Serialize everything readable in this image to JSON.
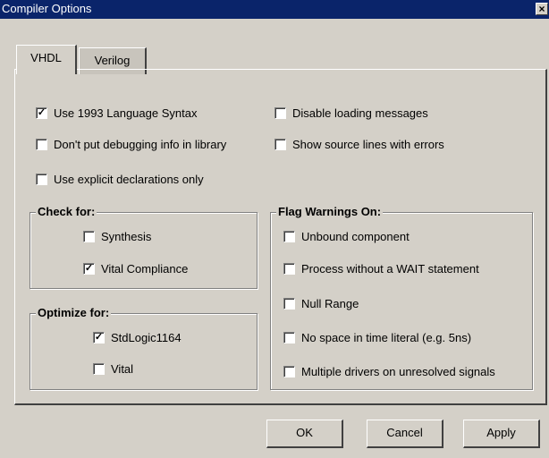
{
  "window": {
    "title": "Compiler Options",
    "close_glyph": "×"
  },
  "tabs": [
    {
      "label": "VHDL",
      "active": true
    },
    {
      "label": "Verilog",
      "active": false
    }
  ],
  "options": {
    "use_1993": {
      "label": "Use 1993 Language Syntax",
      "checked": true
    },
    "no_debug": {
      "label": "Don't put debugging info in library",
      "checked": false
    },
    "explicit_decl": {
      "label": "Use explicit declarations only",
      "checked": false
    },
    "disable_loading": {
      "label": "Disable loading messages",
      "checked": false
    },
    "show_source": {
      "label": "Show source lines with errors",
      "checked": false
    }
  },
  "check_for": {
    "title": "Check for:",
    "synthesis": {
      "label": "Synthesis",
      "checked": false
    },
    "vital_compliance": {
      "label": "Vital Compliance",
      "checked": true
    }
  },
  "optimize_for": {
    "title": "Optimize for:",
    "stdlogic": {
      "label": "StdLogic1164",
      "checked": true
    },
    "vital": {
      "label": "Vital",
      "checked": false
    }
  },
  "flag_warnings": {
    "title": "Flag Warnings On:",
    "unbound": {
      "label": "Unbound component",
      "checked": false
    },
    "process_no_wait": {
      "label": "Process without a WAIT statement",
      "checked": false
    },
    "null_range": {
      "label": "Null Range",
      "checked": false
    },
    "no_space_time": {
      "label": "No space in time literal (e.g. 5ns)",
      "checked": false
    },
    "multiple_drivers": {
      "label": "Multiple drivers on unresolved signals",
      "checked": false
    }
  },
  "buttons": {
    "ok": "OK",
    "cancel": "Cancel",
    "apply": "Apply"
  },
  "check_glyph": "✓"
}
